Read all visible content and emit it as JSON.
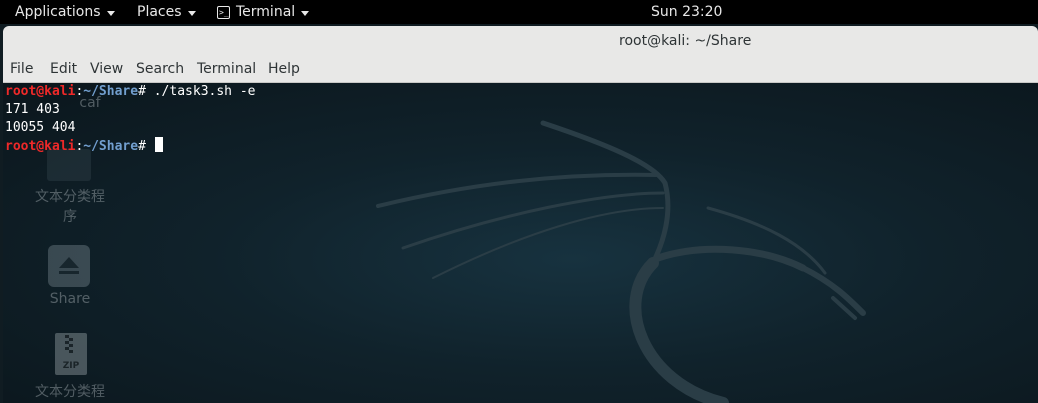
{
  "top_panel": {
    "applications_label": "Applications",
    "places_label": "Places",
    "terminal_label": "Terminal",
    "clock": "Sun 23:20"
  },
  "window": {
    "title": "root@kali: ~/Share"
  },
  "menubar": {
    "items": [
      "File",
      "Edit",
      "View",
      "Search",
      "Terminal",
      "Help"
    ]
  },
  "terminal": {
    "prompt_user": "root@kali",
    "prompt_sep": ":",
    "prompt_path": "~/Share",
    "prompt_symbol": "# ",
    "command": "./task3.sh -e",
    "output_lines": [
      "171 403",
      "10055 404"
    ],
    "colors": {
      "user": "#ef2929",
      "path": "#729fcf",
      "text": "#ffffff"
    }
  },
  "desktop_icons": [
    {
      "name": "caf",
      "icon": "file-icon"
    },
    {
      "name": "文本分类程序",
      "icon": "file-icon"
    },
    {
      "name": "Share",
      "icon": "eject-drive-icon"
    },
    {
      "name": "文本分类程",
      "icon": "zip-archive-icon",
      "badge": "ZIP"
    }
  ]
}
